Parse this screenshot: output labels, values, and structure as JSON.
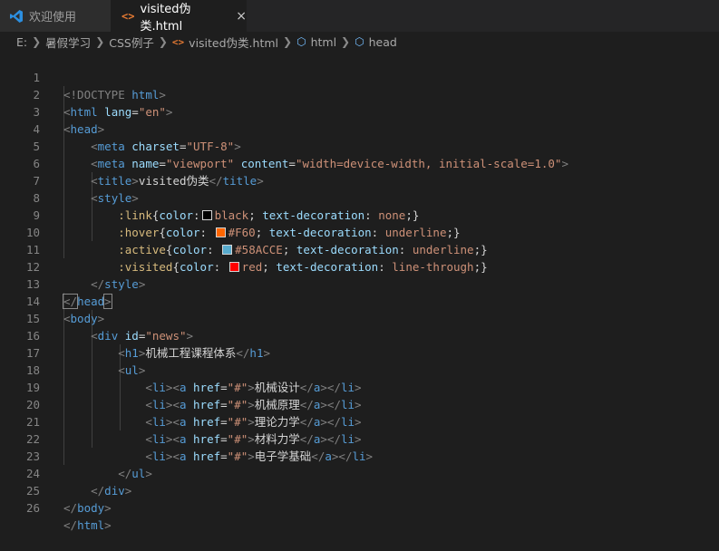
{
  "tabs": [
    {
      "label": "欢迎使用",
      "icon": "vscode-icon"
    },
    {
      "label": "visited伪类.html",
      "icon": "html-file-icon",
      "close": "×"
    }
  ],
  "breadcrumb": {
    "items": [
      "E:",
      "暑假学习",
      "CSS例子",
      "visited伪类.html",
      "html",
      "head"
    ]
  },
  "line_numbers": [
    "1",
    "2",
    "3",
    "4",
    "5",
    "6",
    "7",
    "8",
    "9",
    "10",
    "11",
    "12",
    "13",
    "14",
    "15",
    "16",
    "17",
    "18",
    "19",
    "20",
    "21",
    "22",
    "23",
    "24",
    "25",
    "26"
  ],
  "code": {
    "l1": {
      "doctype": "<!DOCTYPE",
      "html": "html",
      "close": ">"
    },
    "l2": {
      "open": "<",
      "tag": "html",
      "attr": "lang",
      "eq": "=",
      "val": "\"en\"",
      "close": ">"
    },
    "l3": {
      "open": "<",
      "tag": "head",
      "close": ">"
    },
    "l4": {
      "open": "<",
      "tag": "meta",
      "attr": "charset",
      "eq": "=",
      "val": "\"UTF-8\"",
      "close": ">"
    },
    "l5": {
      "open": "<",
      "tag": "meta",
      "attr1": "name",
      "eq1": "=",
      "val1": "\"viewport\"",
      "attr2": "content",
      "eq2": "=",
      "val2": "\"width=device-width, initial-scale=1.0\"",
      "close": ">"
    },
    "l6": {
      "open": "<",
      "tag": "title",
      "close": ">",
      "text": "visited伪类",
      "open2": "</",
      "tag2": "title",
      "close2": ">"
    },
    "l7": {
      "open": "<",
      "tag": "style",
      "close": ">"
    },
    "l8": {
      "selector": ":link",
      "brace": "{",
      "prop": "color",
      "colon": ":",
      "value": "black",
      "semi": ";",
      "prop2": "text-decoration",
      "colon2": ":",
      "value2": "none",
      "end": ";}",
      "swatch": "#000000"
    },
    "l9": {
      "selector": ":hover",
      "brace": "{",
      "prop": "color",
      "colon": ":",
      "value": "#F60",
      "semi": ";",
      "prop2": "text-decoration",
      "colon2": ":",
      "value2": "underline",
      "end": ";}",
      "swatch": "#ff6600"
    },
    "l10": {
      "selector": ":active",
      "brace": "{",
      "prop": "color",
      "colon": ":",
      "value": "#58ACCE",
      "semi": ";",
      "prop2": "text-decoration",
      "colon2": ":",
      "value2": "underline",
      "end": ";}",
      "swatch": "#58acce"
    },
    "l11": {
      "selector": ":visited",
      "brace": "{",
      "prop": "color",
      "colon": ":",
      "value": "red",
      "semi": ";",
      "prop2": "text-decoration",
      "colon2": ":",
      "value2": "line-through",
      "end": ";}",
      "swatch": "#ff0000"
    },
    "l12": {
      "open": "</",
      "tag": "style",
      "close": ">"
    },
    "l13": {
      "open": "</",
      "tag": "head",
      "close": ">"
    },
    "l14": {
      "open": "<",
      "tag": "body",
      "close": ">"
    },
    "l15": {
      "open": "<",
      "tag": "div",
      "attr": "id",
      "eq": "=",
      "val": "\"news\"",
      "close": ">"
    },
    "l16": {
      "open": "<",
      "tag": "h1",
      "close": ">",
      "text": "机械工程课程体系",
      "open2": "</",
      "tag2": "h1",
      "close2": ">"
    },
    "l17": {
      "open": "<",
      "tag": "ul",
      "close": ">"
    },
    "items": [
      {
        "text": "机械设计"
      },
      {
        "text": "机械原理"
      },
      {
        "text": "理论力学"
      },
      {
        "text": "材料力学"
      },
      {
        "text": "电子学基础"
      }
    ],
    "li": {
      "open": "<",
      "tag": "li",
      "close": ">",
      "a_open": "<",
      "a_tag": "a",
      "attr": "href",
      "eq": "=",
      "val": "\"#\"",
      "a_close": ">",
      "end_a": "</",
      "end_a_tag": "a",
      "end_a_close": ">",
      "end_li": "</",
      "end_li_tag": "li",
      "end_li_close": ">"
    },
    "l23": {
      "open": "</",
      "tag": "ul",
      "close": ">"
    },
    "l24": {
      "open": "</",
      "tag": "div",
      "close": ">"
    },
    "l25": {
      "open": "</",
      "tag": "body",
      "close": ">"
    },
    "l26": {
      "open": "</",
      "tag": "html",
      "close": ">"
    }
  },
  "colors": {
    "background": "#1e1e1e",
    "tag": "#569cd6",
    "attribute": "#9cdcfe",
    "string": "#ce9178",
    "selector": "#d7ba7d",
    "punctuation": "#808080"
  }
}
